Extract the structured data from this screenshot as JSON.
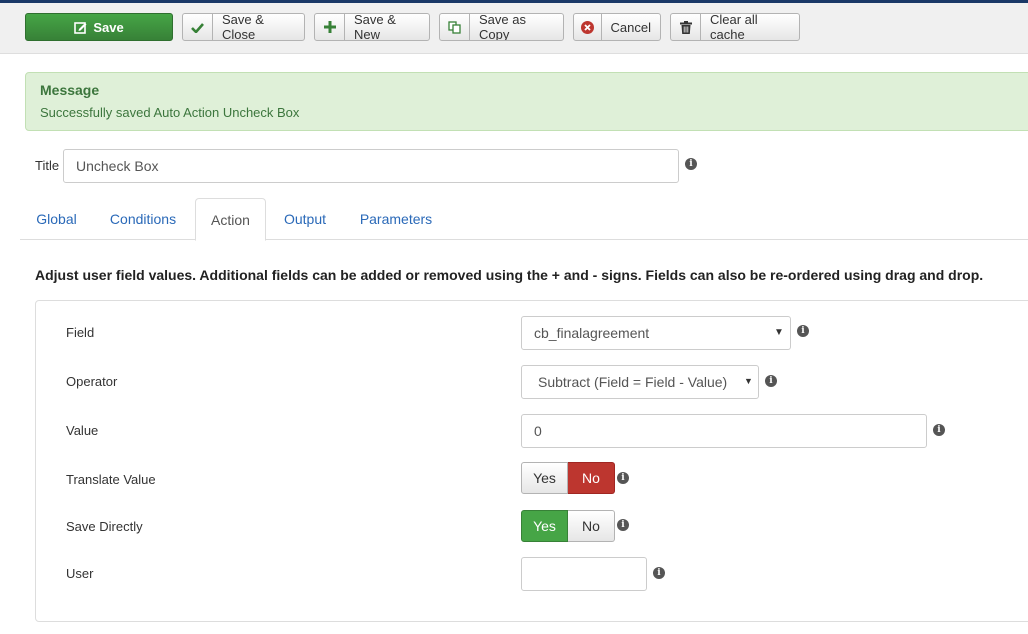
{
  "toolbar": {
    "save": "Save",
    "save_close": "Save & Close",
    "save_new": "Save & New",
    "save_copy": "Save as Copy",
    "cancel": "Cancel",
    "clear_cache": "Clear all cache"
  },
  "message": {
    "heading": "Message",
    "text": "Successfully saved Auto Action Uncheck Box"
  },
  "title_field": {
    "label": "Title",
    "value": "Uncheck Box"
  },
  "tabs": [
    {
      "label": "Global"
    },
    {
      "label": "Conditions"
    },
    {
      "label": "Action",
      "active": true
    },
    {
      "label": "Output"
    },
    {
      "label": "Parameters"
    }
  ],
  "description": "Adjust user field values. Additional fields can be added or removed using the + and - signs. Fields can also be re-ordered using drag and drop.",
  "form": {
    "field": {
      "label": "Field",
      "value": "cb_finalagreement"
    },
    "operator": {
      "label": "Operator",
      "value": "Subtract (Field = Field - Value)"
    },
    "value": {
      "label": "Value",
      "value": "0"
    },
    "translate_value": {
      "label": "Translate Value",
      "yes": "Yes",
      "no": "No",
      "selected": "No"
    },
    "save_directly": {
      "label": "Save Directly",
      "yes": "Yes",
      "no": "No",
      "selected": "Yes"
    },
    "user": {
      "label": "User",
      "value": ""
    }
  },
  "icons": {
    "save": "pencil-square-icon",
    "save_close": "checkmark-icon",
    "save_new": "plus-icon",
    "save_copy": "copy-icon",
    "cancel": "cancel-circle-icon",
    "clear_cache": "trash-icon",
    "info": "info-icon"
  },
  "colors": {
    "primary_green": "#46a546",
    "danger_red": "#bd362f",
    "link_blue": "#2a69b8",
    "message_bg": "#dff0d8",
    "message_text": "#3c763d"
  }
}
